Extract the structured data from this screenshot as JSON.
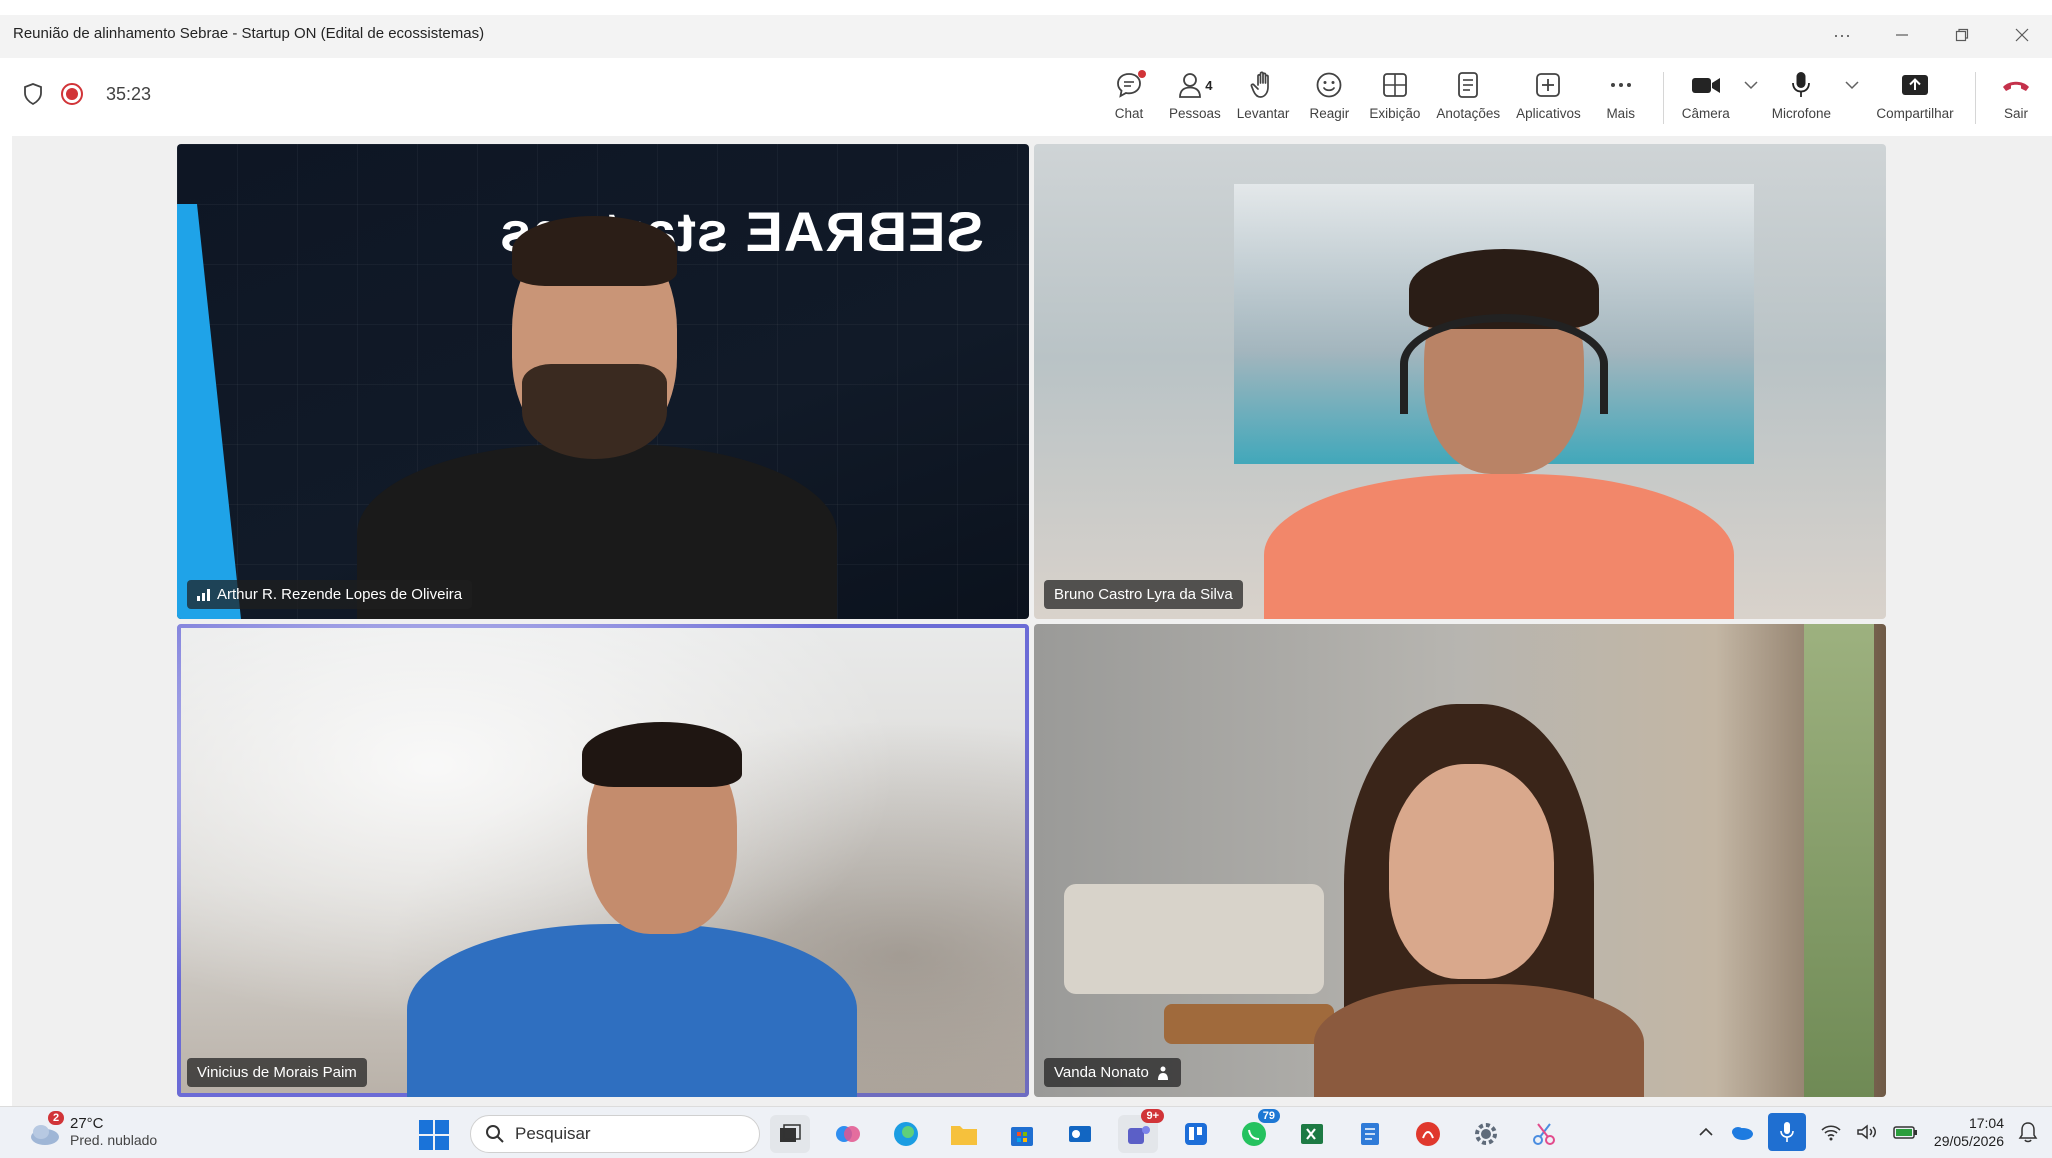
{
  "window": {
    "title": "Reunião de alinhamento Sebrae - Startup ON (Edital de ecossistemas)",
    "more_label": "···"
  },
  "meeting": {
    "timer": "35:23",
    "toolbar": {
      "chat": "Chat",
      "people": "Pessoas",
      "people_count": "4",
      "raise": "Levantar",
      "react": "Reagir",
      "view": "Exibição",
      "notes": "Anotações",
      "apps": "Aplicativos",
      "more": "Mais",
      "camera": "Câmera",
      "mic": "Microfone",
      "share": "Compartilhar",
      "leave": "Sair"
    }
  },
  "participants": [
    {
      "name": "Arthur R. Rezende Lopes de Oliveira",
      "background_text": "SEBRAE startups"
    },
    {
      "name": "Bruno Castro Lyra da Silva"
    },
    {
      "name": "Vinicius de Morais Paim"
    },
    {
      "name": "Vanda Nonato"
    }
  ],
  "taskbar": {
    "weather_temp": "27°C",
    "weather_desc": "Pred. nublado",
    "weather_badge": "2",
    "search_placeholder": "Pesquisar",
    "teams_badge": "9+",
    "whatsapp_badge": "79",
    "time": "17:04",
    "date": "29/05/2026"
  },
  "colors": {
    "accent": "#6b6bd6",
    "record": "#d13438",
    "leave": "#c4314b",
    "sebrae_blue": "#1fa3e8"
  }
}
